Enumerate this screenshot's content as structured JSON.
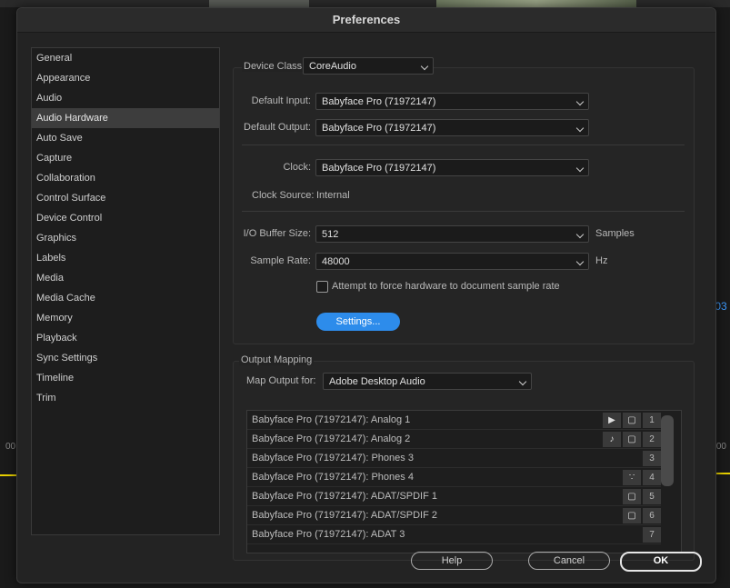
{
  "title": "Preferences",
  "sidebar": {
    "items": [
      {
        "label": "General"
      },
      {
        "label": "Appearance"
      },
      {
        "label": "Audio"
      },
      {
        "label": "Audio Hardware"
      },
      {
        "label": "Auto Save"
      },
      {
        "label": "Capture"
      },
      {
        "label": "Collaboration"
      },
      {
        "label": "Control Surface"
      },
      {
        "label": "Device Control"
      },
      {
        "label": "Graphics"
      },
      {
        "label": "Labels"
      },
      {
        "label": "Media"
      },
      {
        "label": "Media Cache"
      },
      {
        "label": "Memory"
      },
      {
        "label": "Playback"
      },
      {
        "label": "Sync Settings"
      },
      {
        "label": "Timeline"
      },
      {
        "label": "Trim"
      }
    ],
    "selected": "Audio Hardware"
  },
  "device": {
    "class_label": "Device Class:",
    "class_value": "CoreAudio",
    "default_input_label": "Default Input:",
    "default_input_value": "Babyface Pro (71972147)",
    "default_output_label": "Default Output:",
    "default_output_value": "Babyface Pro (71972147)",
    "clock_label": "Clock:",
    "clock_value": "Babyface Pro (71972147)",
    "clock_source_label": "Clock Source:",
    "clock_source_value": "Internal",
    "buffer_label": "I/O Buffer Size:",
    "buffer_value": "512",
    "buffer_unit": "Samples",
    "sample_rate_label": "Sample Rate:",
    "sample_rate_value": "48000",
    "sample_rate_unit": "Hz",
    "force_rate_label": "Attempt to force hardware to document sample rate",
    "force_rate_checked": false,
    "settings_button": "Settings..."
  },
  "output_mapping": {
    "section_title": "Output Mapping",
    "map_label": "Map Output for:",
    "map_value": "Adobe Desktop Audio",
    "rows": [
      {
        "label": "Babyface Pro (71972147):  Analog 1",
        "icons": [
          "play-icon",
          "frame-icon"
        ],
        "num": "1"
      },
      {
        "label": "Babyface Pro (71972147):  Analog 2",
        "icons": [
          "speaker-icon",
          "frame-icon"
        ],
        "num": "2"
      },
      {
        "label": "Babyface Pro (71972147):  Phones 3",
        "icons": [],
        "num": "3"
      },
      {
        "label": "Babyface Pro (71972147):  Phones 4",
        "icons": [
          "bass-clef-icon"
        ],
        "num": "4"
      },
      {
        "label": "Babyface Pro (71972147):  ADAT/SPDIF 1",
        "icons": [
          "frame-icon"
        ],
        "num": "5"
      },
      {
        "label": "Babyface Pro (71972147):  ADAT/SPDIF 2",
        "icons": [
          "frame-icon"
        ],
        "num": "6"
      },
      {
        "label": "Babyface Pro (71972147):  ADAT 3",
        "icons": [],
        "num": "7"
      }
    ]
  },
  "buttons": {
    "help": "Help",
    "cancel": "Cancel",
    "ok": "OK"
  },
  "background": {
    "right_timecode": ":03",
    "left_tick": "00",
    "right_tick": "00"
  },
  "colors": {
    "accent": "#2d8ceb",
    "dialog_bg": "#232323",
    "selected_item": "#3d3d3d"
  }
}
